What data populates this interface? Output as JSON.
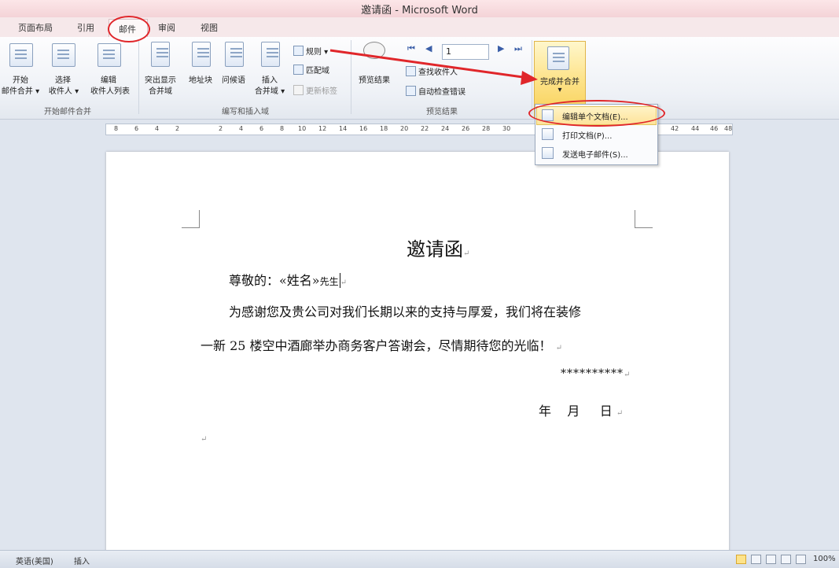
{
  "window": {
    "title": "邀请函 - Microsoft Word"
  },
  "tabs": [
    "页面布局",
    "引用",
    "邮件",
    "审阅",
    "视图"
  ],
  "active_tab": "邮件",
  "ribbon": {
    "group_start": {
      "label": "开始邮件合并",
      "start_merge": [
        "开始",
        "邮件合并 ▾"
      ],
      "select_recipients": [
        "选择",
        "收件人 ▾"
      ],
      "edit_list": [
        "编辑",
        "收件人列表"
      ]
    },
    "group_write": {
      "label": "编写和插入域",
      "highlight_fields": [
        "突出显示",
        "合并域"
      ],
      "address_block": "地址块",
      "greeting_line": "问候语",
      "insert_field": [
        "插入",
        "合并域 ▾"
      ],
      "rules": "规则 ▾",
      "match_fields": "匹配域",
      "update_labels": "更新标签"
    },
    "group_preview": {
      "label": "预览结果",
      "preview_results": "预览结果",
      "record_number": "1",
      "find_recipient": "查找收件人",
      "auto_check": "自动检查错误"
    },
    "group_finish": {
      "finish_merge": "完成并合并",
      "arrow": "▾"
    }
  },
  "finish_menu": [
    {
      "label": "编辑单个文档(E)...",
      "icon": "edit-document-icon"
    },
    {
      "label": "打印文档(P)...",
      "icon": "printer-icon"
    },
    {
      "label": "发送电子邮件(S)...",
      "icon": "email-send-icon"
    }
  ],
  "ruler_ticks": [
    "8",
    "6",
    "4",
    "2",
    "2",
    "4",
    "6",
    "8",
    "10",
    "12",
    "14",
    "16",
    "18",
    "20",
    "22",
    "24",
    "26",
    "28",
    "30",
    "42",
    "44",
    "46",
    "48"
  ],
  "document": {
    "title": "邀请函",
    "salutation_prefix": "尊敬的：",
    "merge_field": "«姓名»",
    "salutation_suffix": "先生",
    "body_line1": "为感谢您及贵公司对我们长期以来的支持与厚爱，我们将在装修",
    "body_line2": "一新 25 楼空中酒廊举办商务客户答谢会，尽情期待您的光临！",
    "signature": "**********",
    "date": "年    月     日",
    "paragraph_mark": "↵"
  },
  "status_bar": {
    "language": "英语(美国)",
    "mode": "插入",
    "zoom": "100%"
  },
  "colors": {
    "annotation_red": "#e0262a",
    "finish_highlight": "#fde38a"
  }
}
